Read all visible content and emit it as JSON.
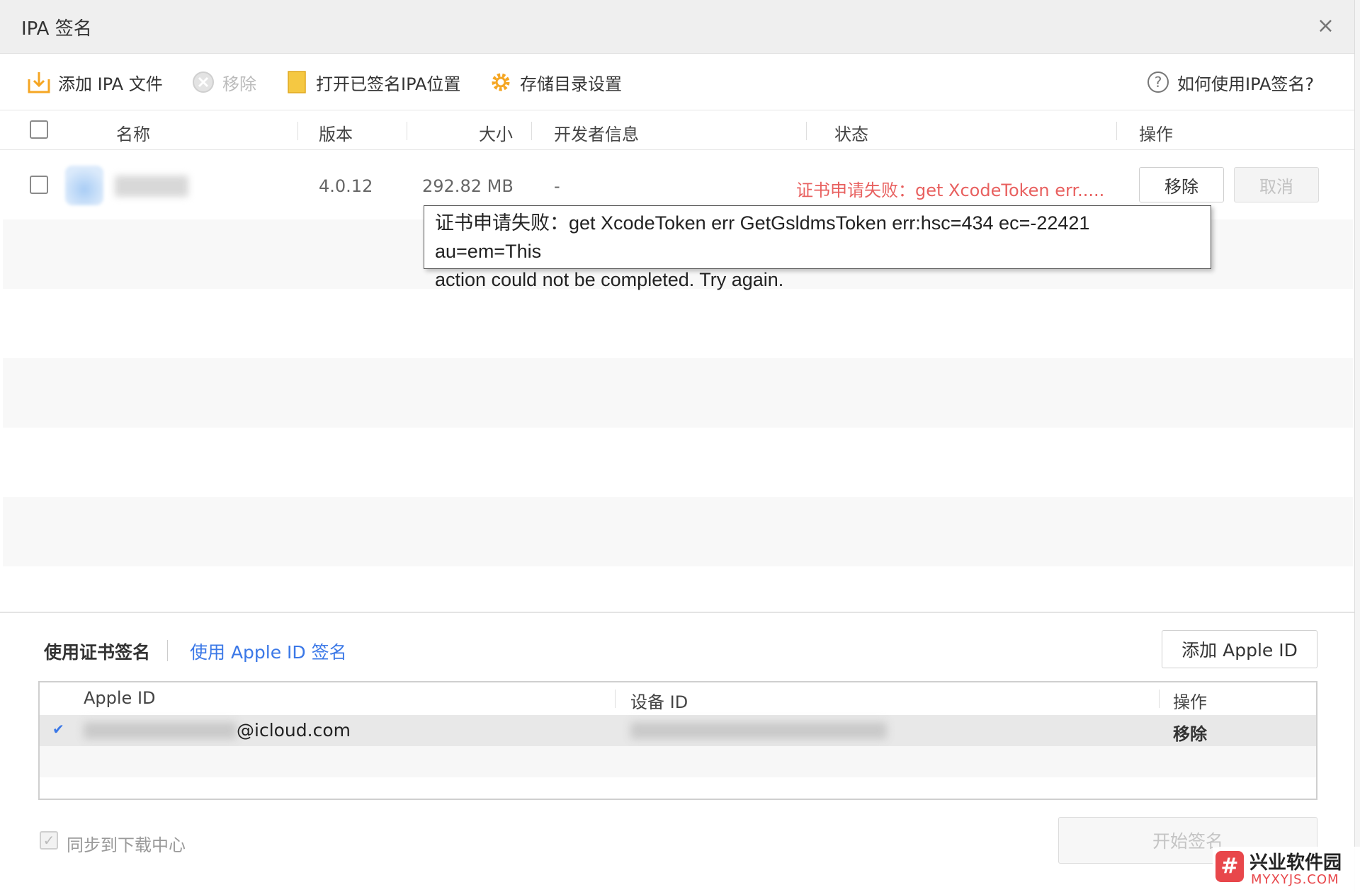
{
  "window": {
    "title": "IPA 签名",
    "close_glyph": "×"
  },
  "toolbar": {
    "add_ipa": "添加 IPA 文件",
    "remove": "移除",
    "open_signed_location": "打开已签名IPA位置",
    "storage_settings": "存储目录设置",
    "help": "如何使用IPA签名?"
  },
  "table": {
    "headers": {
      "name": "名称",
      "version": "版本",
      "size": "大小",
      "developer": "开发者信息",
      "status": "状态",
      "action": "操作"
    },
    "rows": [
      {
        "version": "4.0.12",
        "size": "292.82 MB",
        "developer": "-",
        "status": "证书申请失败：get XcodeToken err.....",
        "remove_label": "移除",
        "cancel_label": "取消"
      }
    ]
  },
  "tooltip": {
    "line1": "证书申请失败：get XcodeToken err GetGsldmsToken err:hsc=434 ec=-22421 au=em=This",
    "line2": "action could not be completed. Try again."
  },
  "signing": {
    "tab_certificate": "使用证书签名",
    "tab_apple_id": "使用 Apple ID 签名",
    "add_apple_id": "添加 Apple ID",
    "headers": {
      "apple_id": "Apple ID",
      "device_id": "设备 ID",
      "action": "操作"
    },
    "accounts": [
      {
        "checked_glyph": "✔",
        "email_suffix": "@icloud.com",
        "action": "移除"
      }
    ]
  },
  "footer": {
    "sync_label": "同步到下载中心",
    "start_button": "开始签名"
  },
  "watermark": {
    "logo_glyph": "#",
    "name": "兴业软件园",
    "url": "MYXYJS.COM"
  },
  "colors": {
    "accent_blue": "#3b78e7",
    "error_red": "#e8605f",
    "folder_yellow": "#f5b92e"
  }
}
